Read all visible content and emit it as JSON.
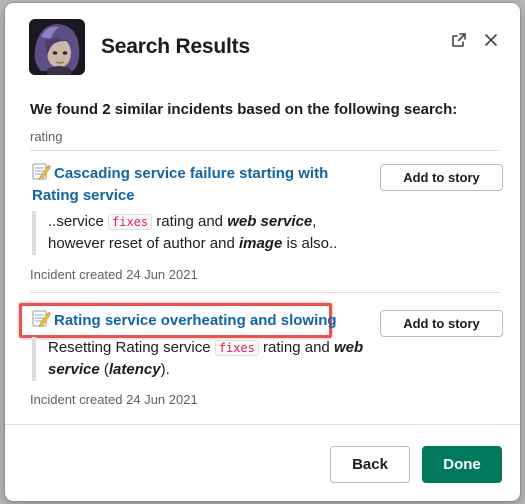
{
  "modal": {
    "title": "Search Results",
    "intro": "We found 2 similar incidents based on the following search:",
    "query": "rating"
  },
  "results": [
    {
      "title": "Cascading service failure starting with Rating service",
      "snippet": {
        "p1": "..service ",
        "code": "fixes",
        "p2": " rating and ",
        "em1": "web service",
        "p3": ", however reset of author and ",
        "em2": "image",
        "p4": " is also.."
      },
      "meta": "Incident created 24 Jun 2021",
      "button": "Add to story"
    },
    {
      "title": "Rating service overheating and slowing",
      "snippet": {
        "p1": "Resetting Rating service ",
        "code": "fixes",
        "p2": " rating and ",
        "em1": "web service",
        "p3": " (",
        "em2": "latency",
        "p4": ")."
      },
      "meta": "Incident created 24 Jun 2021",
      "button": "Add to story"
    }
  ],
  "footer": {
    "back_label": "Back",
    "done_label": "Done"
  },
  "colors": {
    "link": "#1264a3",
    "primary": "#007a5a",
    "code_text": "#e01e5a",
    "highlight": "#e8534f"
  },
  "icons": {
    "result": "memo-icon",
    "popout": "external-link-icon",
    "close": "close-icon"
  }
}
